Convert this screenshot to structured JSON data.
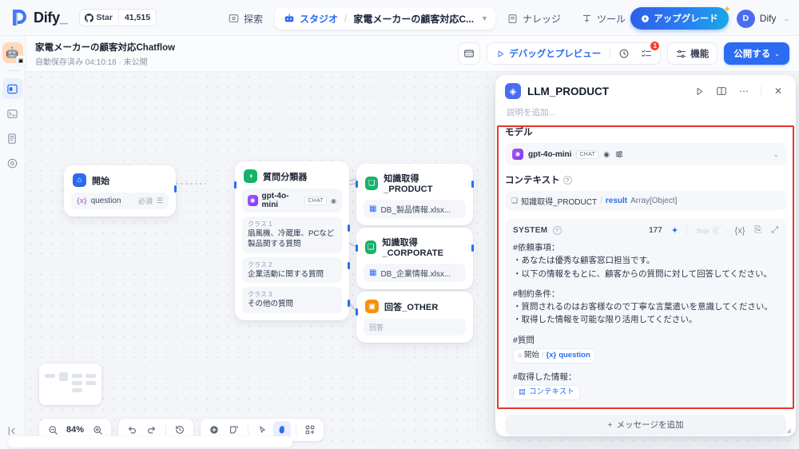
{
  "topbar": {
    "brand": "Dify",
    "brand_cursor": "_",
    "star_label": "Star",
    "star_count": "41,515",
    "nav": [
      {
        "label": "探索",
        "icon": "compass-icon",
        "active": false
      },
      {
        "label": "スタジオ",
        "icon": "robot-icon",
        "active": true
      },
      {
        "label": "ナレッジ",
        "icon": "book-icon",
        "active": false
      },
      {
        "label": "ツール",
        "icon": "tool-icon",
        "active": false
      }
    ],
    "breadcrumb_sep": "/",
    "breadcrumb_current": "家電メーカーの顧客対応C...",
    "upgrade_label": "アップグレード",
    "user_initial": "D",
    "user_name": "Dify"
  },
  "subbar": {
    "flow_title": "家電メーカーの顧客対応Chatflow",
    "flow_status": "自動保存済み 04:10:18 · 未公開",
    "env_icon": "env-icon",
    "debug_label": "デバッグとプレビュー",
    "history_icon": "history-icon",
    "checklist_icon": "checklist-icon",
    "checklist_badge": "1",
    "features_label": "機能",
    "publish_label": "公開する"
  },
  "rail": {
    "items": [
      {
        "icon": "app-avatar-icon",
        "name": "app-avatar",
        "active": false
      },
      {
        "icon": "workflow-icon",
        "name": "rail-item-workflow",
        "active": true
      },
      {
        "icon": "logs-icon",
        "name": "rail-item-logs",
        "active": false
      },
      {
        "icon": "dataset-icon",
        "name": "rail-item-dataset",
        "active": false
      },
      {
        "icon": "monitoring-icon",
        "name": "rail-item-monitoring",
        "active": false
      }
    ],
    "collapse_icon": "collapse-left-icon"
  },
  "canvas": {
    "zoom": "84%",
    "nodes": [
      {
        "id": "start",
        "title": "開始",
        "icon": "home-icon",
        "icon_color": "#2b6cf0",
        "fields": [
          {
            "var": "{x}",
            "name": "question",
            "meta": "必須"
          }
        ]
      },
      {
        "id": "classifier",
        "title": "質問分類器",
        "icon": "classifier-icon",
        "icon_color": "#17b26a",
        "model": {
          "name": "gpt-4o-mini",
          "tag": "CHAT"
        },
        "classes": [
          {
            "label": "クラス 1",
            "text": "扇風機、冷蔵庫、PCなど製品関する質問"
          },
          {
            "label": "クラス 2",
            "text": "企業活動に関する質問"
          },
          {
            "label": "クラス 3",
            "text": "その他の質問"
          }
        ]
      },
      {
        "id": "kb_product",
        "title": "知識取得_PRODUCT",
        "icon": "knowledge-icon",
        "icon_color": "#17b26a",
        "dataset": "DB_製品情報.xlsx..."
      },
      {
        "id": "kb_corporate",
        "title": "知識取得_CORPORATE",
        "icon": "knowledge-icon",
        "icon_color": "#17b26a",
        "dataset": "DB_企業情報.xlsx..."
      },
      {
        "id": "answer_other",
        "title": "回答_OTHER",
        "icon": "answer-icon",
        "icon_color": "#f79009",
        "field": "回答"
      }
    ]
  },
  "panel": {
    "icon": "llm-icon",
    "title": "LLM_PRODUCT",
    "actions": [
      "run-icon",
      "split-view-icon",
      "more-icon",
      "close-icon"
    ],
    "description_placeholder": "説明を追加...",
    "model_section_label": "モデル",
    "model": {
      "name": "gpt-4o-mini",
      "tag": "CHAT",
      "eye_icon": "eye-icon",
      "tune_icon": "sliders-icon"
    },
    "context_section_label": "コンテキスト",
    "context": {
      "node": "知識取得_PRODUCT",
      "sep": "/",
      "variable": "result",
      "type": "Array[Object]"
    },
    "prompt": {
      "role": "SYSTEM",
      "char_count": "177",
      "jinja_label": "Jinja",
      "toolbar_icons": [
        "magic-icon",
        "jinja-toggle",
        "variable-icon",
        "copy-icon",
        "expand-icon"
      ],
      "lines": [
        {
          "type": "text",
          "value": "#依頼事項："
        },
        {
          "type": "text",
          "value": "・あなたは優秀な顧客窓口担当です。"
        },
        {
          "type": "text",
          "value": "・以下の情報をもとに、顧客からの質問に対して回答してください。"
        },
        {
          "type": "blank"
        },
        {
          "type": "text",
          "value": "#制約条件："
        },
        {
          "type": "text",
          "value": "・質問されるのはお客様なので丁寧な言葉遣いを意識してください。"
        },
        {
          "type": "text",
          "value": "・取得した情報を可能な限り活用してください。"
        },
        {
          "type": "blank"
        },
        {
          "type": "text",
          "value": "#質問"
        },
        {
          "type": "var",
          "node": "開始",
          "sep": "/",
          "var_sym": "{x}",
          "var_name": "question"
        },
        {
          "type": "blank"
        },
        {
          "type": "text",
          "value": "#取得した情報："
        },
        {
          "type": "ctx",
          "value": "コンテキスト"
        }
      ]
    },
    "add_message_label": "メッセージを追加",
    "highlight_color": "#e8342a"
  }
}
